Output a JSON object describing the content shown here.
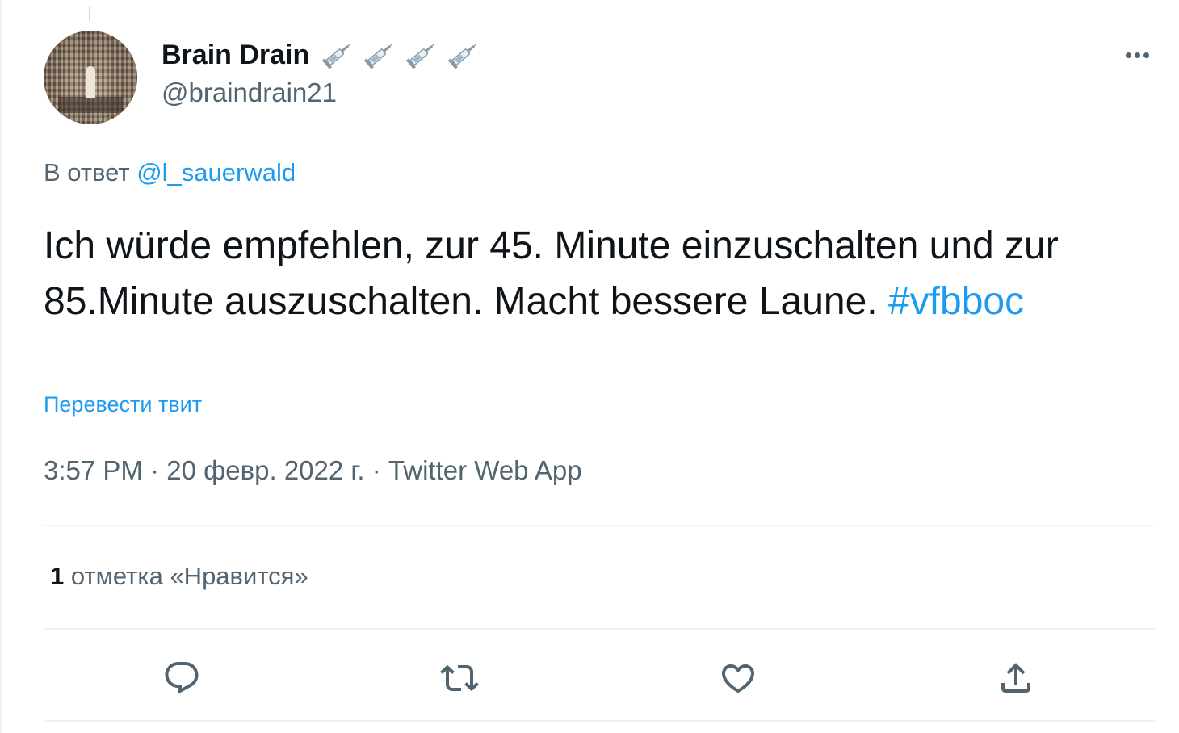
{
  "author": {
    "display_name": "Brain Drain",
    "emoji_icons": [
      "syringe-icon",
      "syringe-icon",
      "syringe-icon",
      "syringe-icon"
    ],
    "handle": "@braindrain21"
  },
  "reply": {
    "prefix": "В ответ",
    "mention": "@l_sauerwald"
  },
  "tweet": {
    "text": "Ich würde empfehlen, zur 45. Minute einzuschalten und zur 85.Minute auszuschalten. Macht bessere Laune. ",
    "hashtag": "#vfbboc",
    "translate_label": "Перевести твит"
  },
  "meta": {
    "time": "3:57 PM",
    "separator1": " · ",
    "date": "20 февр. 2022 г.",
    "separator2": " · ",
    "source": "Twitter Web App"
  },
  "stats": {
    "like_count": "1",
    "like_label": " отметка «Нравится»"
  },
  "actions": [
    "reply-icon",
    "retweet-icon",
    "like-icon",
    "share-icon"
  ],
  "colors": {
    "accent": "#1d9bf0",
    "text_primary": "#0f1419",
    "text_secondary": "#536471",
    "divider": "#eff3f4"
  }
}
